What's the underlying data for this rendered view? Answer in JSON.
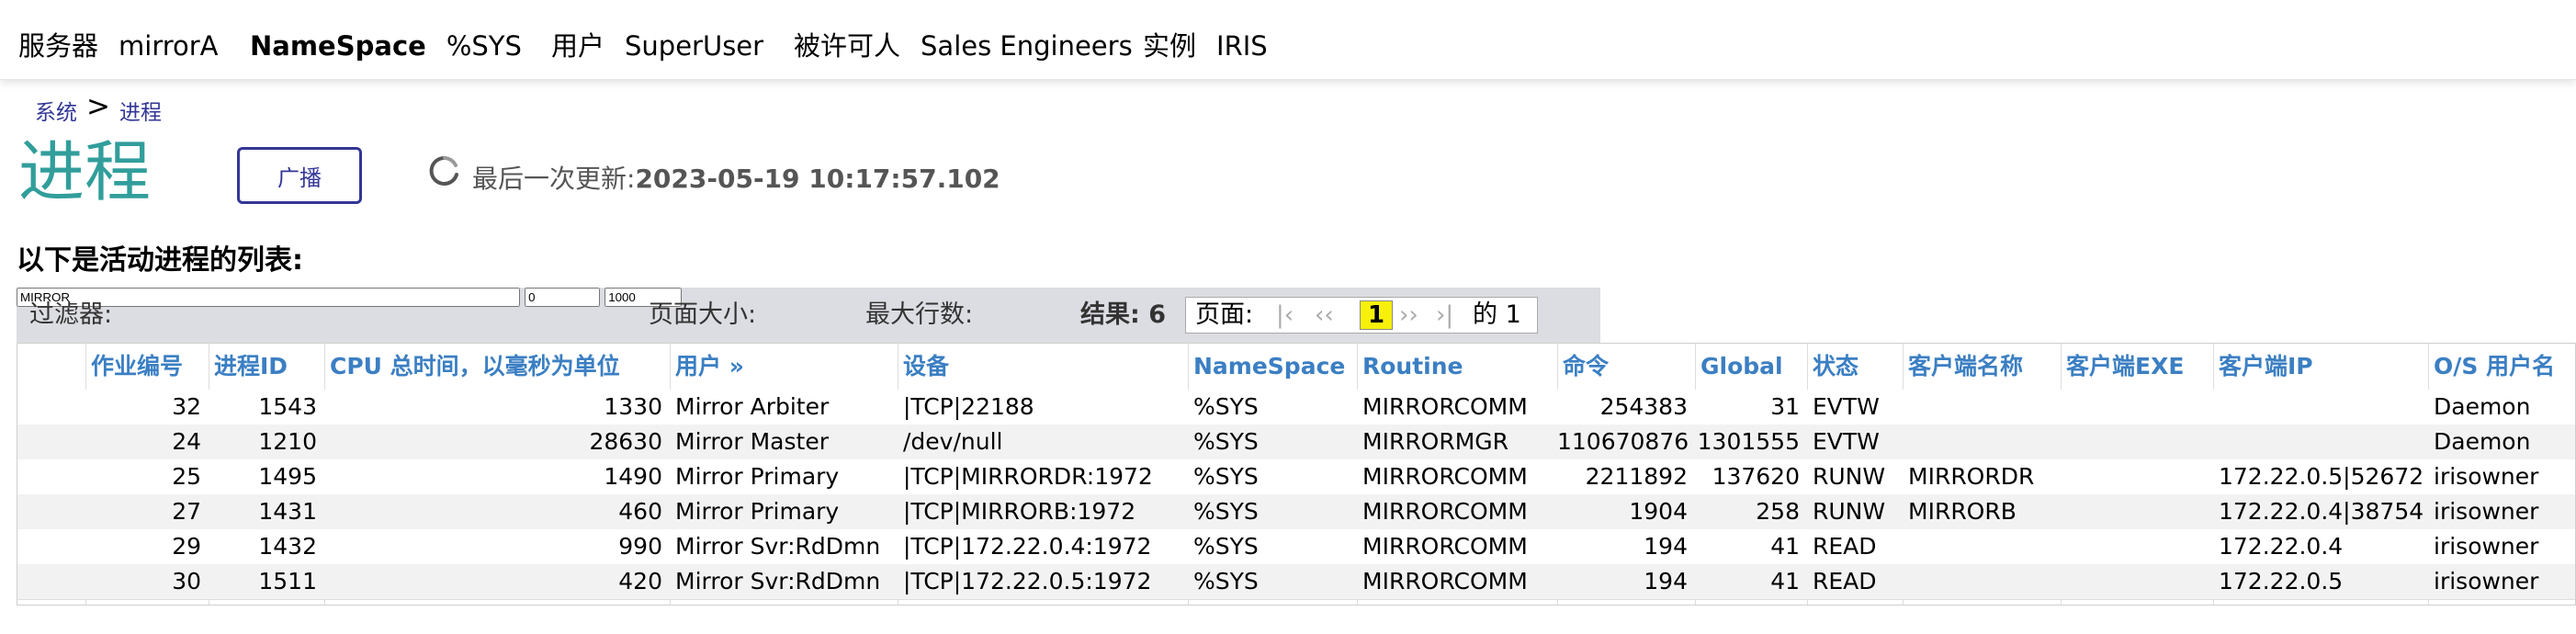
{
  "header": {
    "server_label": "服务器",
    "server_value": "mirrorA",
    "namespace_label": "NameSpace",
    "namespace_value": "%SYS",
    "user_label": "用户",
    "user_value": "SuperUser",
    "licensee_label": "被许可人",
    "licensee_value": "Sales Engineers",
    "instance_label": "实例",
    "instance_value": "IRIS"
  },
  "breadcrumb": {
    "system": "系统",
    "sep": ">",
    "current": "进程"
  },
  "page_title": "进程",
  "broadcast_button": "广播",
  "last_update": {
    "label": "最后一次更新:",
    "value": "2023-05-19 10:17:57.102"
  },
  "list_heading": "以下是活动进程的列表:",
  "filter": {
    "filter_label": "过滤器:",
    "filter_value": "MIRROR",
    "page_size_label": "页面大小:",
    "page_size_value": "0",
    "max_rows_label": "最大行数:",
    "max_rows_value": "1000",
    "results_label": "结果:",
    "results_value": "6",
    "page_label": "页面:",
    "nav_first": "|‹",
    "nav_prev": "‹‹",
    "current_page": "1",
    "nav_next": "››",
    "nav_last": "›|",
    "of_label": "的",
    "total_pages": "1"
  },
  "table": {
    "headers": [
      "作业编号",
      "进程ID",
      "CPU 总时间，以毫秒为单位",
      "用户 »",
      "设备",
      "NameSpace",
      "Routine",
      "命令",
      "Global",
      "状态",
      "客户端名称",
      "客户端EXE",
      "客户端IP",
      "O/S 用户名"
    ],
    "rows": [
      [
        "32",
        "1543",
        "1330",
        "Mirror Arbiter",
        "|TCP|22188",
        "%SYS",
        "MIRRORCOMM",
        "254383",
        "31",
        "EVTW",
        "",
        "",
        "",
        "Daemon"
      ],
      [
        "24",
        "1210",
        "28630",
        "Mirror Master",
        "/dev/null",
        "%SYS",
        "MIRRORMGR",
        "110670876",
        "1301555",
        "EVTW",
        "",
        "",
        "",
        "Daemon"
      ],
      [
        "25",
        "1495",
        "1490",
        "Mirror Primary",
        "|TCP|MIRRORDR:1972",
        "%SYS",
        "MIRRORCOMM",
        "2211892",
        "137620",
        "RUNW",
        "MIRRORDR",
        "",
        "172.22.0.5|52672",
        "irisowner"
      ],
      [
        "27",
        "1431",
        "460",
        "Mirror Primary",
        "|TCP|MIRRORB:1972",
        "%SYS",
        "MIRRORCOMM",
        "1904",
        "258",
        "RUNW",
        "MIRRORB",
        "",
        "172.22.0.4|38754",
        "irisowner"
      ],
      [
        "29",
        "1432",
        "990",
        "Mirror Svr:RdDmn",
        "|TCP|172.22.0.4:1972",
        "%SYS",
        "MIRRORCOMM",
        "194",
        "41",
        "READ",
        "",
        "",
        "172.22.0.4",
        "irisowner"
      ],
      [
        "30",
        "1511",
        "420",
        "Mirror Svr:RdDmn",
        "|TCP|172.22.0.5:1972",
        "%SYS",
        "MIRRORCOMM",
        "194",
        "41",
        "READ",
        "",
        "",
        "172.22.0.5",
        "irisowner"
      ]
    ]
  },
  "colors": {
    "title_teal": "#319e9b",
    "link_blue": "#333695",
    "header_blue": "#3b7fc3",
    "current_page_yellow": "#f6f00a"
  },
  "icons": {
    "refresh": "refresh-icon"
  }
}
